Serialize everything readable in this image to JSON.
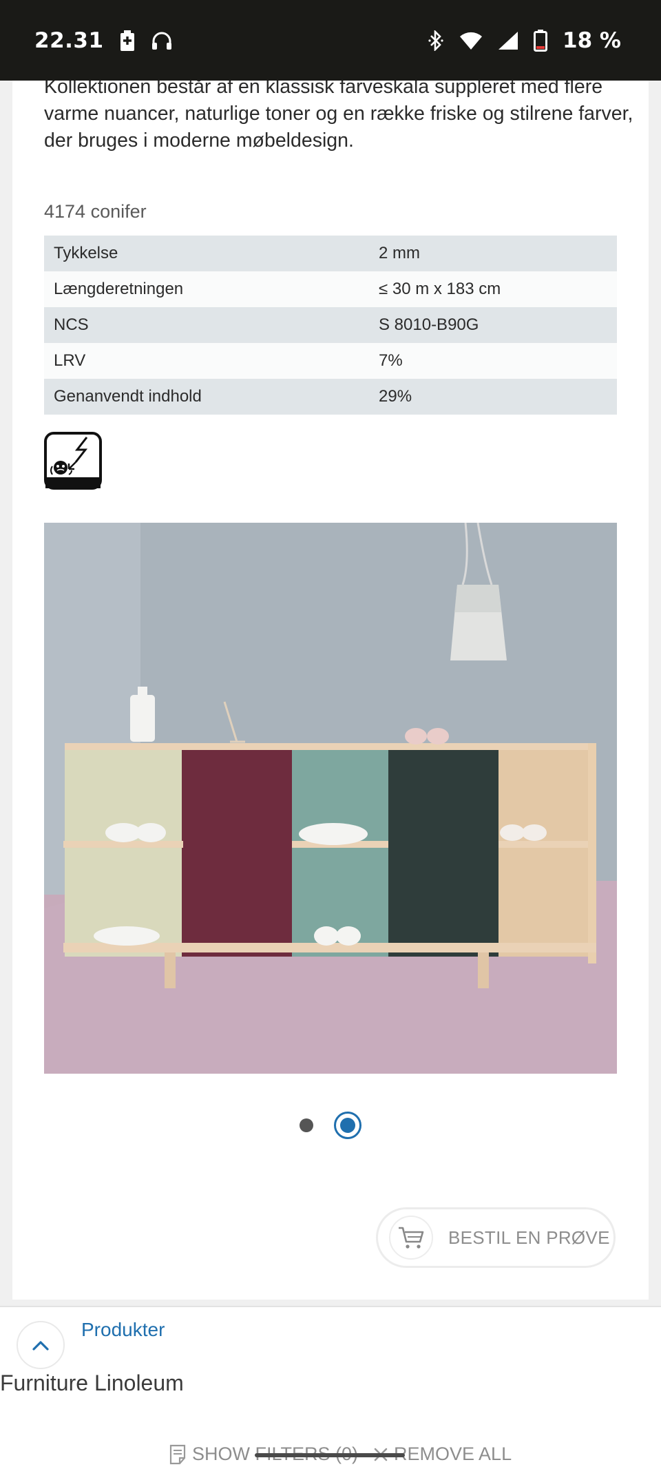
{
  "status_bar": {
    "time": "22.31",
    "battery_percent": "18 %",
    "icons": [
      "battery-saver-icon",
      "headphones-icon",
      "bluetooth-icon",
      "wifi-icon",
      "cellular-signal-icon",
      "battery-icon"
    ]
  },
  "content": {
    "description": "Kollektionen består af en klassisk farveskala suppleret med flere varme nuancer, naturlige toner og en række friske og stilrene farver, der bruges i moderne møbeldesign.",
    "product_code": "4174 conifer",
    "specs": [
      {
        "label": "Tykkelse",
        "value": "2 mm"
      },
      {
        "label": "Længderetningen",
        "value": "≤ 30 m x 183 cm"
      },
      {
        "label": "NCS",
        "value": "S 8010-B90G"
      },
      {
        "label": "LRV",
        "value": "7%"
      },
      {
        "label": "Genanvendt indhold",
        "value": "29%"
      }
    ],
    "feature_icon": "antistatic-icon",
    "image_alt": "Shelf with colored linoleum doors and shoes",
    "carousel": {
      "count": 2,
      "active": 2
    },
    "order_sample_label": "BESTIL EN PRØVE"
  },
  "bottom": {
    "breadcrumb_link": "Produkter",
    "title": "Furniture Linoleum",
    "show_filters": "SHOW FILTERS (0)",
    "remove_all": "REMOVE ALL"
  },
  "colors": {
    "accent": "#1f6fae",
    "table_row_shade": "#e0e5e8",
    "status_bar_bg": "#1a1a17"
  }
}
